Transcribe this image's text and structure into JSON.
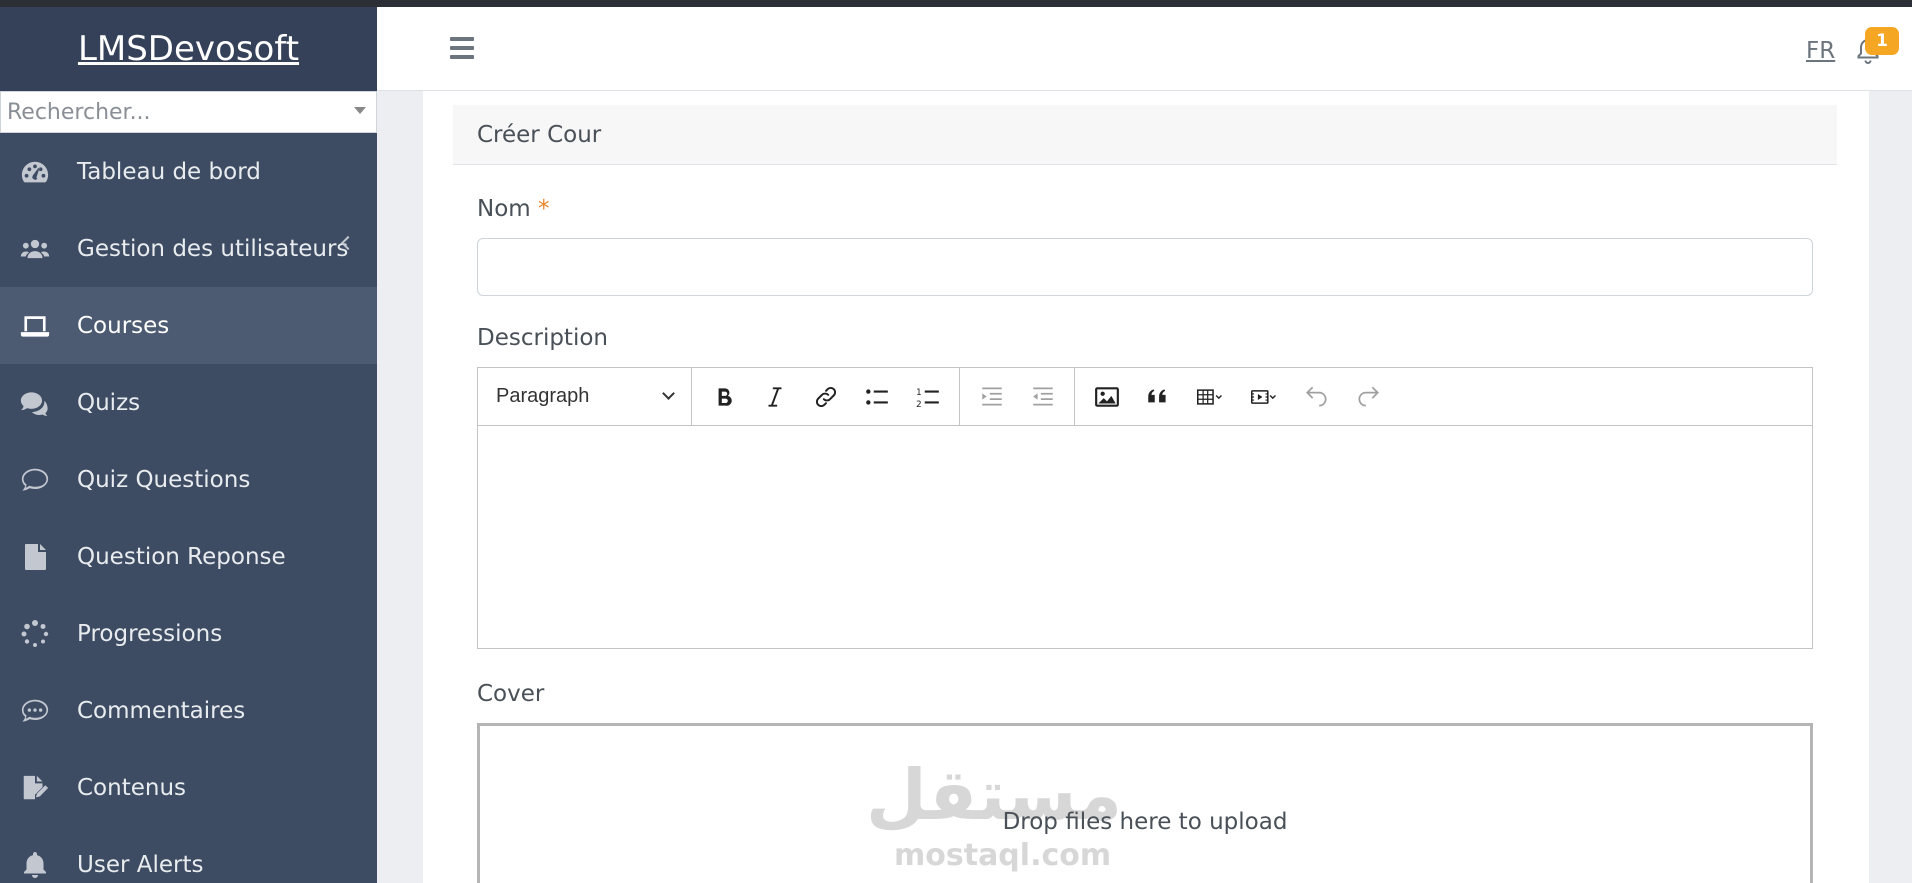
{
  "app": {
    "brand": "LMSDevosoft"
  },
  "sidebar": {
    "search_placeholder": "Rechercher...",
    "items": [
      {
        "label": "Tableau de bord",
        "icon": "dashboard-gauge-icon"
      },
      {
        "label": "Gestion des utilisateurs",
        "icon": "users-group-icon",
        "has_submenu": true
      },
      {
        "label": "Courses",
        "icon": "laptop-icon",
        "active": true
      },
      {
        "label": "Quizs",
        "icon": "comments-icon"
      },
      {
        "label": "Quiz Questions",
        "icon": "comment-outline-icon"
      },
      {
        "label": "Question Reponse",
        "icon": "file-icon"
      },
      {
        "label": "Progressions",
        "icon": "spinner-icon"
      },
      {
        "label": "Commentaires",
        "icon": "comment-dots-icon"
      },
      {
        "label": "Contenus",
        "icon": "file-signature-icon"
      },
      {
        "label": "User Alerts",
        "icon": "bell-icon"
      }
    ]
  },
  "header": {
    "language": "FR",
    "notification_count": "1"
  },
  "form": {
    "title": "Créer Cour",
    "name_label": "Nom",
    "required_mark": "*",
    "description_label": "Description",
    "editor_block_style": "Paragraph",
    "cover_label": "Cover",
    "dropzone_text": "Drop files here to upload"
  },
  "watermark": {
    "arabic": "مستقل",
    "latin": "mostaql.com"
  },
  "colors": {
    "sidebar_bg": "#3d4b63",
    "sidebar_active": "#4c5a72",
    "badge": "#f5a623",
    "required": "#e8862a"
  }
}
